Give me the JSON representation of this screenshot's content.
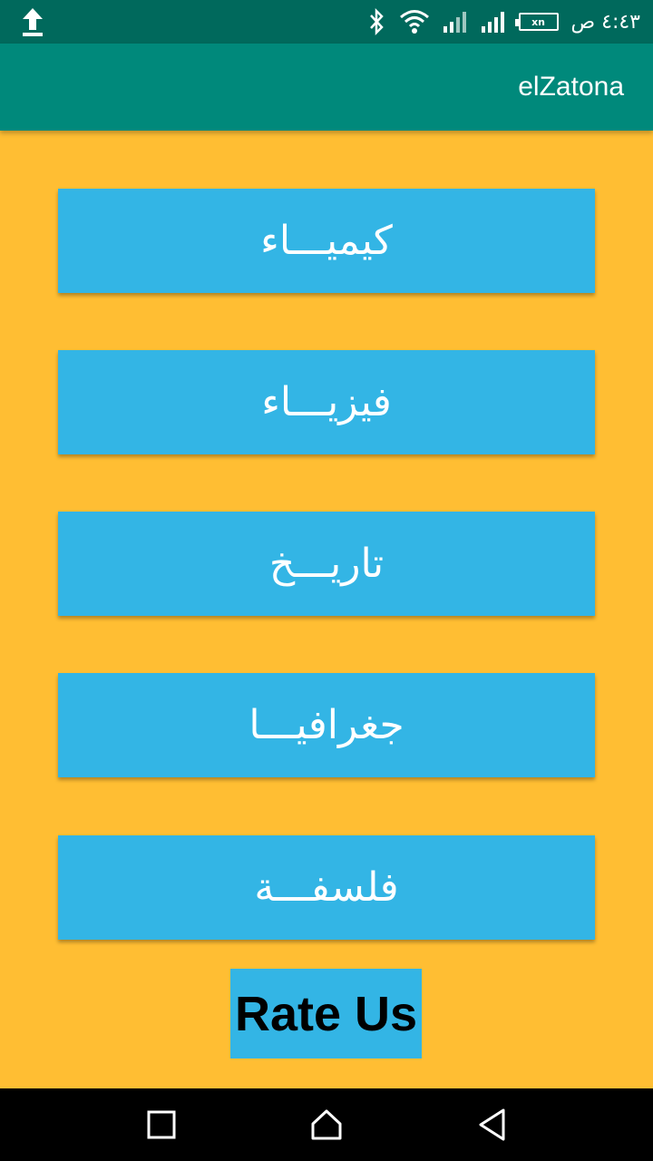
{
  "status_bar": {
    "time": "٤:٤٣ ص",
    "battery_label": "xn",
    "icons": [
      "upload-icon",
      "bluetooth-icon",
      "wifi-icon",
      "signal-icon",
      "signal-icon",
      "battery-icon"
    ]
  },
  "app_bar": {
    "title": "elZatona"
  },
  "subjects": [
    {
      "label": "كيميـــاء"
    },
    {
      "label": "فيزيـــاء"
    },
    {
      "label": "تاريـــخ"
    },
    {
      "label": "جغرافيـــا"
    },
    {
      "label": "فلسفـــة"
    }
  ],
  "rate_button": {
    "label": "Rate Us"
  },
  "nav_bar": {
    "icons": [
      "recent-apps-icon",
      "home-icon",
      "back-icon"
    ]
  },
  "colors": {
    "background": "#FFBE33",
    "status_bar": "#00695C",
    "app_bar": "#00897B",
    "button": "#33B5E5",
    "nav_bar": "#000000"
  }
}
